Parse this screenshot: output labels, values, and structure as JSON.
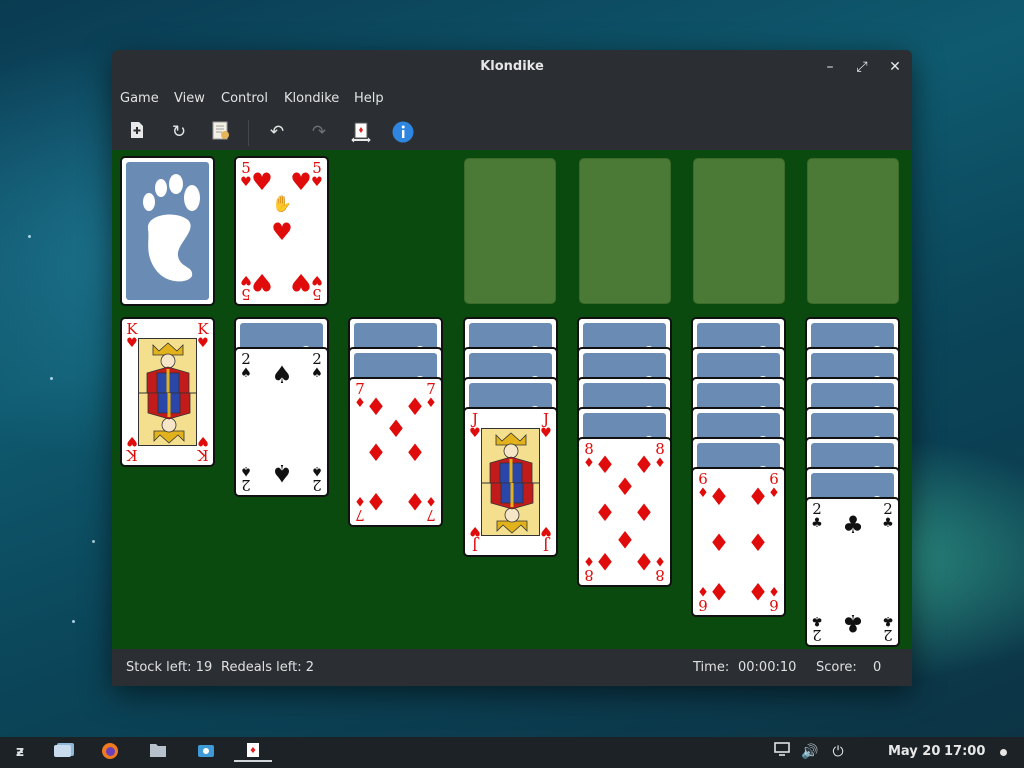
{
  "window": {
    "title": "Klondike",
    "controls": {
      "minimize": "–",
      "maximize": "⤢",
      "close": "✕"
    }
  },
  "menubar": [
    "Game",
    "View",
    "Control",
    "Klondike",
    "Help"
  ],
  "toolbar": {
    "icons": [
      "new-game-icon",
      "restart-icon",
      "select-game-icon",
      "undo-icon",
      "redo-icon",
      "deal-icon",
      "hint-icon"
    ]
  },
  "stock": {
    "face": "back"
  },
  "waste": {
    "rank": "5",
    "suit": "♥",
    "color": "red"
  },
  "foundations": [
    "empty",
    "empty",
    "empty",
    "empty"
  ],
  "tableau": [
    {
      "hidden": 0,
      "face": {
        "rank": "K",
        "suit": "♥",
        "color": "red"
      }
    },
    {
      "hidden": 1,
      "face": {
        "rank": "2",
        "suit": "♠",
        "color": "black"
      }
    },
    {
      "hidden": 2,
      "face": {
        "rank": "7",
        "suit": "♦",
        "color": "red"
      }
    },
    {
      "hidden": 3,
      "face": {
        "rank": "J",
        "suit": "♥",
        "color": "red"
      }
    },
    {
      "hidden": 4,
      "face": {
        "rank": "8",
        "suit": "♦",
        "color": "red"
      }
    },
    {
      "hidden": 5,
      "face": {
        "rank": "6",
        "suit": "♦",
        "color": "red"
      }
    },
    {
      "hidden": 6,
      "face": {
        "rank": "2",
        "suit": "♣",
        "color": "black"
      }
    }
  ],
  "statusbar": {
    "stock_left": "Stock left: 19",
    "redeals_left": "Redeals left: 2",
    "time_label": "Time:",
    "time_value": "00:00:10",
    "score_label": "Score:",
    "score_value": "0"
  },
  "taskbar": {
    "date": "May 20",
    "time": "17:00"
  },
  "colors": {
    "felt": "#0b4a0e",
    "card_back": "#6a8cb4",
    "foundation_slot": "#4a7a36",
    "red_suit": "#e00b0b"
  }
}
